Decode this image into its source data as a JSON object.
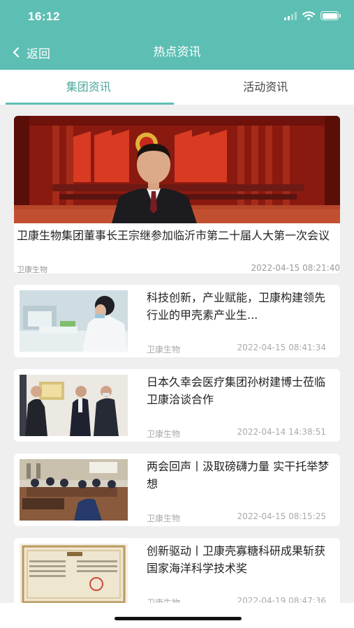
{
  "status_bar": {
    "time": "16:12"
  },
  "nav": {
    "back_label": "返回",
    "title": "热点资讯"
  },
  "theme": {
    "accent": "#5dbfb3",
    "accent_text": "#4ba99d",
    "background": "#efefef"
  },
  "tabs": [
    {
      "label": "集团资讯",
      "active": true
    },
    {
      "label": "活动资讯",
      "active": false
    }
  ],
  "featured": {
    "title": "卫康生物集团董事长王宗继参加临沂市第二十届人大第一次会议",
    "source": "卫康生物",
    "date": "2022-04-15 08:21:40"
  },
  "articles": [
    {
      "title": "科技创新，产业赋能，卫康构建领先行业的甲壳素产业生...",
      "source": "卫康生物",
      "date": "2022-04-15 08:41:34"
    },
    {
      "title": "日本久幸会医疗集团孙树建博士莅临卫康洽谈合作",
      "source": "卫康生物",
      "date": "2022-04-14 14:38:51"
    },
    {
      "title": "两会回声丨汲取磅礴力量 实干托举梦想",
      "source": "卫康生物",
      "date": "2022-04-15 08:15:25"
    },
    {
      "title": "创新驱动丨卫康壳寡糖科研成果斩获国家海洋科学技术奖",
      "source": "卫康生物",
      "date": "2022-04-19 08:47:36"
    }
  ]
}
